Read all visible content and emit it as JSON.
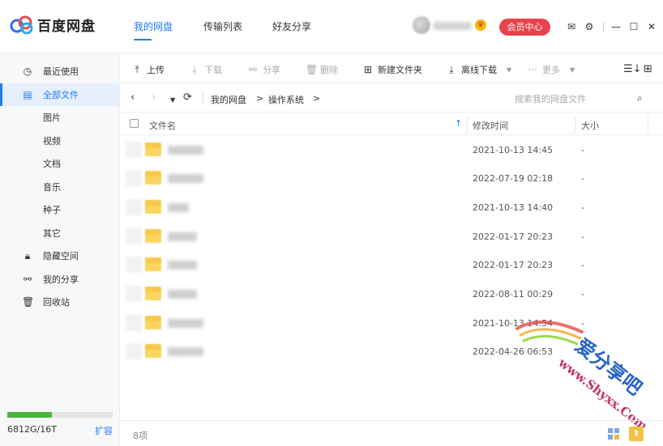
{
  "app": {
    "title": "百度网盘",
    "nav_tabs": [
      {
        "label": "我的网盘",
        "active": true
      },
      {
        "label": "传输列表",
        "active": false
      },
      {
        "label": "好友分享",
        "active": false
      }
    ],
    "vip_button": "会员中心",
    "window_icons": [
      "mail-icon",
      "settings-icon",
      "minimize-icon",
      "maximize-icon",
      "close-icon"
    ]
  },
  "sidebar": {
    "items": [
      {
        "label": "最近使用",
        "icon": "clock-icon",
        "active": false
      },
      {
        "label": "全部文件",
        "icon": "file-icon",
        "active": true
      },
      {
        "label": "图片",
        "icon": "",
        "active": false
      },
      {
        "label": "视频",
        "icon": "",
        "active": false
      },
      {
        "label": "文档",
        "icon": "",
        "active": false
      },
      {
        "label": "音乐",
        "icon": "",
        "active": false
      },
      {
        "label": "种子",
        "icon": "",
        "active": false
      },
      {
        "label": "其它",
        "icon": "",
        "active": false
      },
      {
        "label": "隐藏空间",
        "icon": "lock-icon",
        "active": false
      },
      {
        "label": "我的分享",
        "icon": "share-icon",
        "active": false
      },
      {
        "label": "回收站",
        "icon": "trash-icon",
        "active": false
      }
    ],
    "storage": {
      "text": "6812G/16T",
      "used_fraction": 0.4258,
      "expand_label": "扩容"
    }
  },
  "toolbar": {
    "upload": "上传",
    "download": "下载",
    "share": "分享",
    "delete": "删除",
    "new_folder": "新建文件夹",
    "offline_download": "离线下载",
    "more": "更多"
  },
  "path": {
    "crumbs": [
      "我的网盘",
      "操作系统"
    ],
    "separator": ">",
    "search_placeholder": "搜索我的网盘文件"
  },
  "table": {
    "columns": {
      "name": "文件名",
      "modified": "修改时间",
      "size": "大小"
    },
    "rows": [
      {
        "modified": "2021-10-13 14:45",
        "size": "-"
      },
      {
        "modified": "2022-07-19 02:18",
        "size": "-"
      },
      {
        "modified": "2021-10-13 14:40",
        "size": "-"
      },
      {
        "modified": "2022-01-17 20:23",
        "size": "-"
      },
      {
        "modified": "2022-01-17 20:23",
        "size": "-"
      },
      {
        "modified": "2022-08-11 00:29",
        "size": "-"
      },
      {
        "modified": "2021-10-13 14:54",
        "size": "-"
      },
      {
        "modified": "2022-04-26 06:53",
        "size": "-"
      }
    ]
  },
  "status": {
    "count": "8项"
  },
  "watermark": {
    "text": "爱分享吧",
    "url": "www.Shyxx.Com"
  },
  "colors": {
    "accent": "#1e7cf2",
    "vip": "#e8424a",
    "storage": "#4bb33e",
    "folder": "#f7c94a"
  }
}
